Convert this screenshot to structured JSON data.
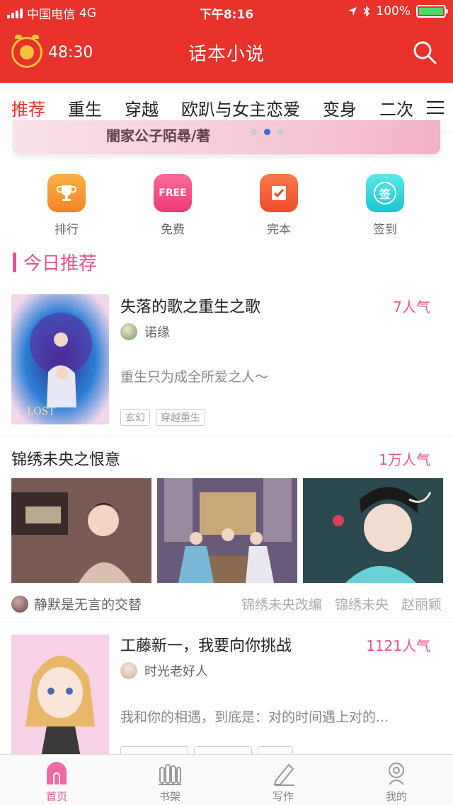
{
  "status": {
    "carrier": "中国电信",
    "network": "4G",
    "time": "下午8:16",
    "battery": "100%"
  },
  "header": {
    "timer": "48:30",
    "title": "话本小说"
  },
  "tabs": [
    "推荐",
    "重生",
    "穿越",
    "欧趴与女主恋爱",
    "变身",
    "二次"
  ],
  "banner": {
    "text": "闇家公子陌尋/著"
  },
  "quick": [
    {
      "label": "排行",
      "color": "#f79a32"
    },
    {
      "label": "免费",
      "color": "#f25a88",
      "badge": "FREE"
    },
    {
      "label": "完本",
      "color": "#f26a3a"
    },
    {
      "label": "签到",
      "color": "#2fd4d4",
      "badge": "签"
    }
  ],
  "section": {
    "title": "今日推荐"
  },
  "book1": {
    "title": "失落的歌之重生之歌",
    "popularity": "7人气",
    "author": "诺缘",
    "desc": "重生只为成全所爱之人～",
    "tags": [
      "玄幻",
      "穿越重生"
    ]
  },
  "book2": {
    "title": "锦绣未央之恨意",
    "popularity": "1万人气",
    "author": "静默是无言的交替",
    "tags": [
      "锦绣未央改编",
      "锦绣未央",
      "赵丽颖"
    ]
  },
  "book3": {
    "title": "工藤新一，我要向你挑战",
    "popularity": "1121人气",
    "author": "时光老好人",
    "desc": "我和你的相遇，到底是：对的时间遇上对的..."
  },
  "nav": [
    {
      "label": "首页"
    },
    {
      "label": "书架"
    },
    {
      "label": "写作"
    },
    {
      "label": "我的"
    }
  ],
  "colors": {
    "brand_red": "#e8322b",
    "accent_pink": "#e9528f"
  }
}
